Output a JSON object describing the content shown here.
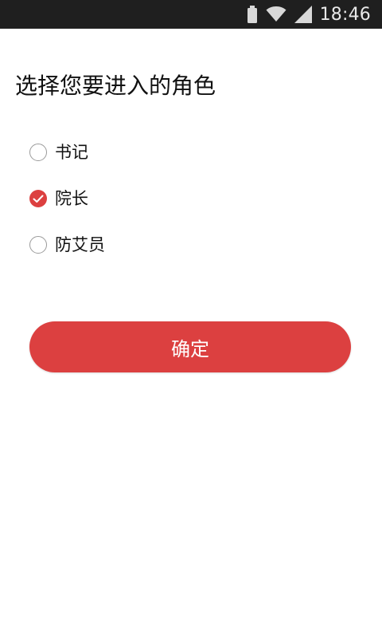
{
  "status_bar": {
    "time": "18:46",
    "icons": [
      "battery-icon",
      "wifi-icon",
      "signal-icon"
    ]
  },
  "page": {
    "title": "选择您要进入的角色"
  },
  "roles": [
    {
      "label": "书记",
      "selected": false
    },
    {
      "label": "院长",
      "selected": true
    },
    {
      "label": "防艾员",
      "selected": false
    }
  ],
  "confirm_button": {
    "label": "确定"
  },
  "colors": {
    "accent": "#dc4040",
    "status_bar": "#1f1f1f"
  }
}
